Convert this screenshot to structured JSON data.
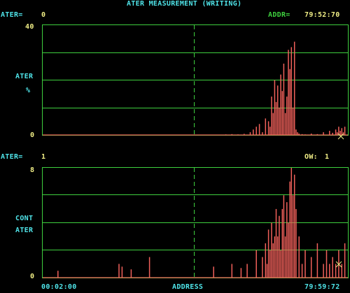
{
  "header": {
    "title": "ATER MEASUREMENT (WRITING)",
    "left_label": "ATER=",
    "left_value": "0",
    "right_label": "ADDR=",
    "right_value": "79:52:70"
  },
  "top_chart": {
    "y_max_label": "40",
    "y_min_label": "0",
    "ylabel_line1": "ATER",
    "ylabel_line2": "%"
  },
  "mid_status": {
    "left_label": "ATER=",
    "left_value": "1",
    "right_label": "OW:",
    "right_value": "1"
  },
  "bottom_chart": {
    "y_max_label": "8",
    "y_min_label": "0",
    "ylabel_line1": "CONT",
    "ylabel_line2": "ATER"
  },
  "footer": {
    "start_time": "00:02:00",
    "xlabel": "ADDRESS",
    "end_time": "79:59:72"
  },
  "colors": {
    "background": "#000000",
    "grid": "#3ecf3e",
    "trace": "#f0605a",
    "label_cyan": "#4fe3e8",
    "value_yellow": "#f0ee86",
    "cursor": "#f0ee86"
  },
  "chart_data": [
    {
      "type": "bar",
      "ylim": [
        0,
        40
      ],
      "x": [
        0.6,
        0.62,
        0.64,
        0.66,
        0.68,
        0.69,
        0.7,
        0.71,
        0.72,
        0.73,
        0.74,
        0.745,
        0.75,
        0.755,
        0.76,
        0.765,
        0.77,
        0.775,
        0.78,
        0.785,
        0.79,
        0.795,
        0.8,
        0.805,
        0.81,
        0.815,
        0.82,
        0.825,
        0.83,
        0.835,
        0.84,
        0.85,
        0.86,
        0.88,
        0.9,
        0.92,
        0.94,
        0.95,
        0.96,
        0.965,
        0.97,
        0.975,
        0.98,
        0.985,
        0.99
      ],
      "values": [
        0.2,
        0.3,
        0.2,
        0.4,
        1,
        2,
        3,
        4,
        1,
        6,
        5,
        3,
        14,
        8,
        20,
        12,
        18,
        10,
        22,
        16,
        26,
        8,
        14,
        31,
        24,
        32,
        10,
        34,
        2,
        1,
        0.5,
        0.3,
        0.2,
        0.5,
        0.3,
        1,
        1.5,
        0.8,
        2,
        1,
        3,
        1.5,
        2.5,
        1,
        3
      ]
    },
    {
      "type": "bar",
      "ylim": [
        0,
        8
      ],
      "x": [
        0.05,
        0.25,
        0.26,
        0.29,
        0.35,
        0.56,
        0.62,
        0.65,
        0.67,
        0.7,
        0.72,
        0.73,
        0.735,
        0.74,
        0.745,
        0.75,
        0.755,
        0.76,
        0.765,
        0.77,
        0.775,
        0.78,
        0.785,
        0.79,
        0.795,
        0.8,
        0.805,
        0.81,
        0.815,
        0.82,
        0.825,
        0.83,
        0.84,
        0.85,
        0.86,
        0.88,
        0.9,
        0.92,
        0.93,
        0.94,
        0.95,
        0.96,
        0.97,
        0.98,
        0.99
      ],
      "values": [
        0.5,
        1,
        0.8,
        0.6,
        1.5,
        0.8,
        1,
        0.7,
        1,
        2,
        1.5,
        2.5,
        1,
        3.5,
        2,
        4,
        2.5,
        3,
        5,
        3,
        4.5,
        2,
        5,
        6,
        3,
        5.5,
        4,
        7,
        8,
        6,
        7.5,
        5,
        3,
        1,
        2,
        1.5,
        2.5,
        1,
        2,
        1,
        1.5,
        1,
        2,
        1,
        2.5
      ]
    }
  ]
}
